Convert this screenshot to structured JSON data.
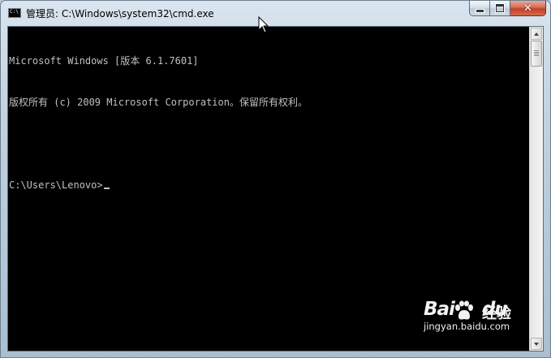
{
  "window": {
    "title": "管理员: C:\\Windows\\system32\\cmd.exe",
    "icon": "cmd-console-icon",
    "caption_buttons": [
      "minimize-icon",
      "maximize-icon",
      "close-icon"
    ]
  },
  "console": {
    "lines": [
      "Microsoft Windows [版本 6.1.7601]",
      "版权所有 (c) 2009 Microsoft Corporation。保留所有权利。",
      "",
      "C:\\Users\\Lenovo>"
    ],
    "text_color": "#c0c0c0",
    "background": "#000000"
  },
  "watermark": {
    "brand_left": "Bai",
    "brand_right": "du",
    "suffix": "经验",
    "url": "jingyan.baidu.com"
  }
}
